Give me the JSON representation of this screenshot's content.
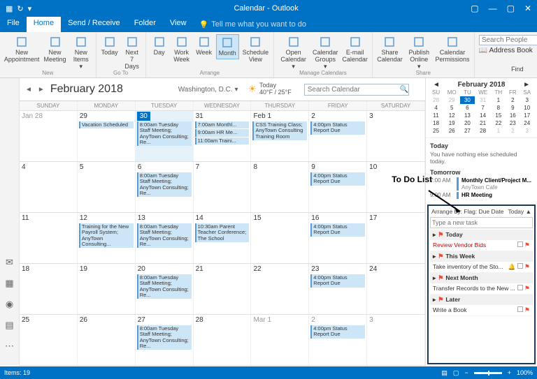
{
  "window": {
    "title": "Calendar",
    "app": "- Outlook"
  },
  "tabs": [
    "File",
    "Home",
    "Send / Receive",
    "Folder",
    "View"
  ],
  "active_tab": 1,
  "tell_me": "Tell me what you want to do",
  "ribbon": {
    "new": {
      "label": "New",
      "items": [
        {
          "l1": "New",
          "l2": "Appointment"
        },
        {
          "l1": "New",
          "l2": "Meeting"
        },
        {
          "l1": "New",
          "l2": "Items ▾"
        }
      ]
    },
    "goto": {
      "label": "Go To",
      "items": [
        {
          "l1": "Today"
        },
        {
          "l1": "Next 7",
          "l2": "Days"
        }
      ]
    },
    "arrange": {
      "label": "Arrange",
      "items": [
        {
          "l1": "Day"
        },
        {
          "l1": "Work",
          "l2": "Week"
        },
        {
          "l1": "Week"
        },
        {
          "l1": "Month",
          "sel": true
        },
        {
          "l1": "Schedule",
          "l2": "View"
        }
      ]
    },
    "manage": {
      "label": "Manage Calendars",
      "items": [
        {
          "l1": "Open",
          "l2": "Calendar ▾"
        },
        {
          "l1": "Calendar",
          "l2": "Groups ▾"
        },
        {
          "l1": "E-mail",
          "l2": "Calendar"
        }
      ]
    },
    "share": {
      "label": "Share",
      "items": [
        {
          "l1": "Share",
          "l2": "Calendar"
        },
        {
          "l1": "Publish",
          "l2": "Online ▾"
        },
        {
          "l1": "Calendar",
          "l2": "Permissions"
        }
      ]
    },
    "find": {
      "label": "Find",
      "search_ph": "Search People",
      "addr": "Address Book"
    }
  },
  "cal": {
    "month": "February 2018",
    "location": "Washington, D.C. ▾",
    "weather": {
      "day": "Today",
      "temp": "40°F / 25°F"
    },
    "search_ph": "Search Calendar",
    "dayheads": [
      "SUNDAY",
      "MONDAY",
      "TUESDAY",
      "WEDNESDAY",
      "THURSDAY",
      "FRIDAY",
      "SATURDAY"
    ],
    "weeks": [
      [
        {
          "n": "Jan 28",
          "om": true
        },
        {
          "n": "29",
          "e": [
            "Vacation Scheduled"
          ]
        },
        {
          "n": "30",
          "today": true,
          "e": [
            "8:00am Tuesday Staff Meeting; AnyTown Consulting; Re..."
          ]
        },
        {
          "n": "31",
          "e": [
            "7:00am Monthl...",
            "9:00am HR Me...",
            "11:00am Traini..."
          ]
        },
        {
          "n": "Feb 1",
          "e": [
            "CSS Training Class; AnyTown Consulting Training Room"
          ]
        },
        {
          "n": "2",
          "e": [
            "4:00pm Status Report Due"
          ]
        },
        {
          "n": "3"
        }
      ],
      [
        {
          "n": "4"
        },
        {
          "n": "5"
        },
        {
          "n": "6",
          "e": [
            "8:00am Tuesday Staff Meeting; AnyTown Consulting; Re..."
          ]
        },
        {
          "n": "7"
        },
        {
          "n": "8"
        },
        {
          "n": "9",
          "e": [
            "4:00pm Status Report Due"
          ]
        },
        {
          "n": "10"
        }
      ],
      [
        {
          "n": "11"
        },
        {
          "n": "12",
          "e": [
            "Training for the New Payroll System; AnyTown Consulting..."
          ]
        },
        {
          "n": "13",
          "e": [
            "8:00am Tuesday Staff Meeting; AnyTown Consulting; Re..."
          ]
        },
        {
          "n": "14",
          "e": [
            "10:30am Parent Teacher Conference; The School"
          ]
        },
        {
          "n": "15"
        },
        {
          "n": "16",
          "e": [
            "4:00pm Status Report Due"
          ]
        },
        {
          "n": "17"
        }
      ],
      [
        {
          "n": "18"
        },
        {
          "n": "19"
        },
        {
          "n": "20",
          "e": [
            "8:00am Tuesday Staff Meeting; AnyTown Consulting; Re..."
          ]
        },
        {
          "n": "21"
        },
        {
          "n": "22"
        },
        {
          "n": "23",
          "e": [
            "4:00pm Status Report Due"
          ]
        },
        {
          "n": "24"
        }
      ],
      [
        {
          "n": "25"
        },
        {
          "n": "26"
        },
        {
          "n": "27",
          "e": [
            "8:00am Tuesday Staff Meeting; AnyTown Consulting; Re..."
          ]
        },
        {
          "n": "28"
        },
        {
          "n": "Mar 1",
          "om": true
        },
        {
          "n": "2",
          "om": true,
          "e": [
            "4:00pm Status Report Due"
          ]
        },
        {
          "n": "3",
          "om": true
        }
      ]
    ]
  },
  "mini": {
    "month": "February 2018",
    "dow": [
      "SU",
      "MO",
      "TU",
      "WE",
      "TH",
      "FR",
      "SA"
    ],
    "rows": [
      [
        {
          "n": 28,
          "om": true
        },
        {
          "n": 29,
          "om": true
        },
        {
          "n": 30,
          "today": true,
          "om": true
        },
        {
          "n": 31,
          "om": true
        },
        {
          "n": 1
        },
        {
          "n": 2
        },
        {
          "n": 3
        }
      ],
      [
        {
          "n": 4
        },
        {
          "n": 5
        },
        {
          "n": 6
        },
        {
          "n": 7
        },
        {
          "n": 8
        },
        {
          "n": 9
        },
        {
          "n": 10
        }
      ],
      [
        {
          "n": 11
        },
        {
          "n": 12
        },
        {
          "n": 13
        },
        {
          "n": 14
        },
        {
          "n": 15
        },
        {
          "n": 16
        },
        {
          "n": 17
        }
      ],
      [
        {
          "n": 18
        },
        {
          "n": 19
        },
        {
          "n": 20
        },
        {
          "n": 21
        },
        {
          "n": 22
        },
        {
          "n": 23
        },
        {
          "n": 24
        }
      ],
      [
        {
          "n": 25
        },
        {
          "n": 26
        },
        {
          "n": 27
        },
        {
          "n": 28
        },
        {
          "n": 1,
          "om": true
        },
        {
          "n": 2,
          "om": true
        },
        {
          "n": 3,
          "om": true
        }
      ]
    ]
  },
  "agenda": {
    "today": {
      "h": "Today",
      "msg": "You have nothing else scheduled today."
    },
    "tomorrow": {
      "h": "Tomorrow",
      "items": [
        {
          "t": "7:00 AM",
          "title": "Monthly Client/Project M...",
          "loc": "AnyTown Cafe"
        },
        {
          "t": "9:00 AM",
          "title": "HR Meeting",
          "loc": ""
        }
      ]
    }
  },
  "todo": {
    "head_l": "Arrange by: Flag: Due Date",
    "head_r": "Today ▲",
    "input_ph": "Type a new task",
    "groups": [
      {
        "g": "Today",
        "items": [
          {
            "t": "Review Vendor Bids",
            "red": true
          }
        ]
      },
      {
        "g": "This Week",
        "items": [
          {
            "t": "Take inventory of the Sto...",
            "bell": true
          }
        ]
      },
      {
        "g": "Next Month",
        "items": [
          {
            "t": "Transfer Records to the New ..."
          }
        ]
      },
      {
        "g": "Later",
        "items": [
          {
            "t": "Write a Book"
          }
        ]
      }
    ]
  },
  "annotation": "To Do List",
  "status": {
    "items": "Items: 19",
    "zoom": "100%"
  }
}
